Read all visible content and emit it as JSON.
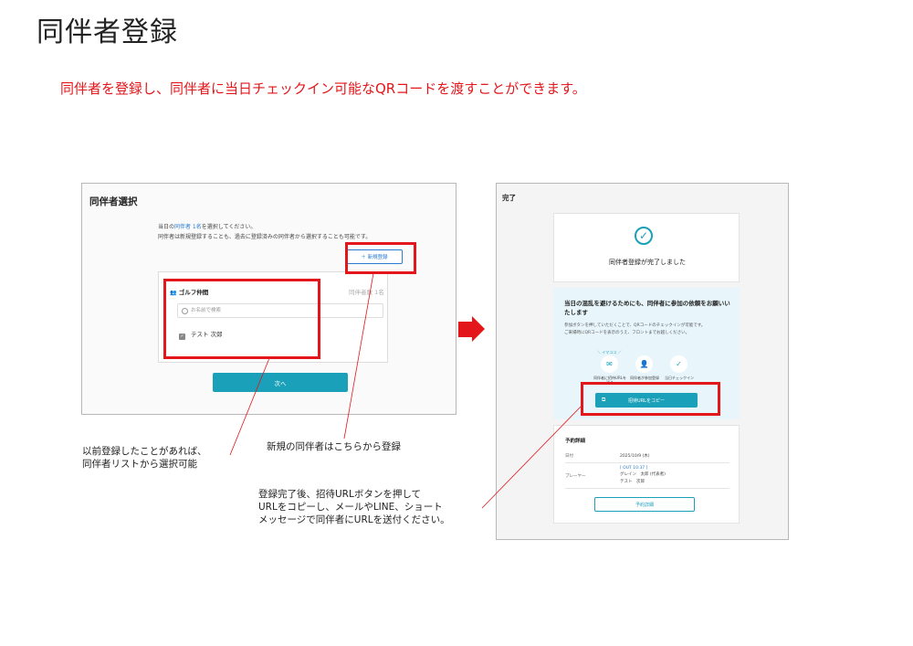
{
  "page": {
    "title": "同伴者登録",
    "subtitle": "同伴者を登録し、同伴者に当日チェックイン可能なQRコードを渡すことができます。"
  },
  "left_screen": {
    "title": "同伴者選択",
    "instruction_pre": "当日の",
    "instruction_link": "同伴者 1名",
    "instruction_post": "を選択してください。",
    "instruction_line2": "同伴者は新規登録することも、過去に登録済みの同伴者から選択することも可能です。",
    "new_register_button": "＋ 新規登録",
    "group_name": "ゴルフ仲間",
    "group_count": "同伴者数 1名",
    "search_placeholder": "お名前で検索",
    "member_name": "テスト 次郎",
    "next_button": "次へ"
  },
  "right_screen": {
    "label": "完了",
    "check_icon": "check-circle-icon",
    "done_message": "同伴者登録が完了しました",
    "notice_heading": "当日の混乱を避けるためにも、同伴者に参加の依頼をお願いいたします",
    "notice_line1": "参加ボタンを押していただくことで、QRコードのチェックインが可能です。",
    "notice_line2": "ご来場時にQRコードを表示のうえ、フロントまでお越しください。",
    "here_tag": "＼ イマココ ／",
    "steps": [
      {
        "icon": "mail-icon",
        "text": "同伴者に招待URLを送る"
      },
      {
        "icon": "user-check-icon",
        "text": "同伴者が参加登録"
      },
      {
        "icon": "check-icon",
        "text": "当日チェックイン"
      }
    ],
    "copy_button": "招待URLをコピー",
    "details_title": "予約詳細",
    "date_key": "日付",
    "date_value": "2025/10/9 (木)",
    "players_key": "プレーヤー",
    "tee_tag": "[ OUT 10:37 ]",
    "player1": "グレイン　太郎 (代表者)",
    "player2": "テスト　次郎",
    "details_button": "予約詳細"
  },
  "callouts": {
    "left_line1": "以前登録したことがあれば、",
    "left_line2": "同伴者リストから選択可能",
    "middle": "新規の同伴者はこちらから登録",
    "bottom_line1": "登録完了後、招待URLボタンを押して",
    "bottom_line2": "URLをコピーし、メールやLINE、ショート",
    "bottom_line3": "メッセージで同伴者にURLを送付ください。"
  },
  "colors": {
    "accent": "#1aa0b8",
    "highlight": "#e3161b",
    "link": "#2b7bd1"
  }
}
